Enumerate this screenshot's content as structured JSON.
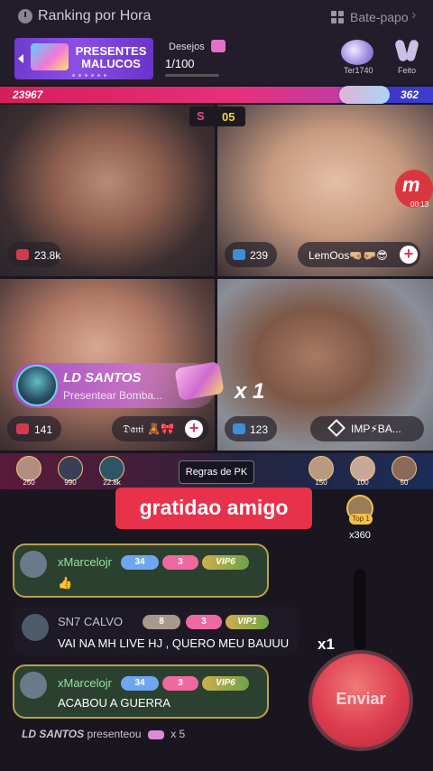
{
  "header": {
    "title": "Ranking por Hora",
    "chat_label": "Bate-papo",
    "clock_icon": "clock-icon",
    "grid_icon": "grid-icon",
    "chevron_icon": "chevron-right-icon"
  },
  "promo": {
    "banner_text": "PRESENTES MALUCOS",
    "wish_label": "Desejos",
    "wish_count": "1/100",
    "top_users": [
      {
        "name": "Ter1740"
      },
      {
        "name": "Feito"
      }
    ]
  },
  "pk": {
    "left_score": "23967",
    "right_score": "362",
    "timer_icon": "S",
    "timer_value": "05",
    "rules_label": "Regras de PK",
    "colors": {
      "left": "#d61e5c",
      "right": "#3b3fcf"
    }
  },
  "streams": [
    {
      "score": "23.8k",
      "name": ""
    },
    {
      "score": "239",
      "name": "LemOos🤜🏼🤛🏼😎"
    },
    {
      "score": "141",
      "name": "𝔇𝔞𝔫𝔦 🧸🎀"
    },
    {
      "score": "123",
      "name": "IMP⚡BA..."
    }
  ],
  "record": {
    "icon": "m",
    "time": "00:13"
  },
  "gift_banner": {
    "sender": "LD SANTOS",
    "description": "Presentear Bomba...",
    "multiplier": "x 1"
  },
  "pk_avatars": {
    "left": [
      "250",
      "990",
      "22.8k"
    ],
    "right": [
      "150",
      "100",
      "50"
    ]
  },
  "sticker_text": "gratidao amigo",
  "top1": {
    "label": "Top 1",
    "count": "x360"
  },
  "messages": [
    {
      "user": "xMarcelojr",
      "level": "34",
      "hearts": "3",
      "vip": "VIP6",
      "text": "👍"
    },
    {
      "user": "SN7 CALVO",
      "level": "8",
      "hearts": "3",
      "vip": "VIP1",
      "text": "VAI NA MH LIVE HJ , QUERO MEU BAUUU"
    },
    {
      "user": "xMarcelojr",
      "level": "34",
      "hearts": "3",
      "vip": "VIP6",
      "text": "ACABOU A GUERRA"
    }
  ],
  "gift_log": {
    "user": "LD SANTOS",
    "action": "presenteou",
    "count": "x 5"
  },
  "send": {
    "label": "Enviar",
    "multiplier": "x1"
  }
}
